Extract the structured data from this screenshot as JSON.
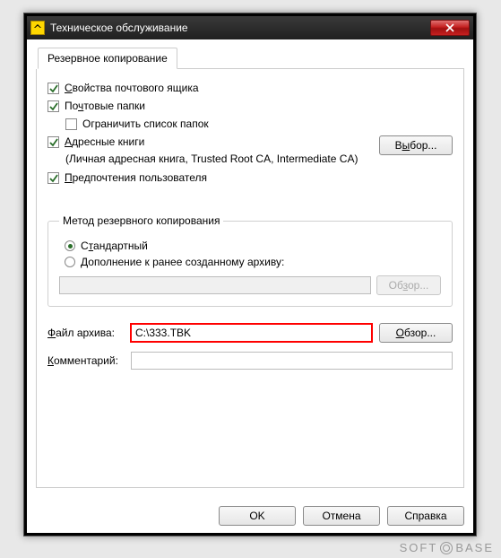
{
  "window": {
    "title": "Техническое обслуживание"
  },
  "tab": {
    "label": "Резервное копирование"
  },
  "checkboxes": {
    "mailbox_props": {
      "label_pre": "",
      "label_u": "С",
      "label_post": "войства почтового ящика",
      "checked": true
    },
    "mail_folders": {
      "label_pre": "По",
      "label_u": "ч",
      "label_post": "товые папки",
      "checked": true
    },
    "limit_folders": {
      "label": "Ограничить список папок",
      "checked": false
    },
    "address_books": {
      "label_pre": "",
      "label_u": "А",
      "label_post": "дресные книги",
      "checked": true
    },
    "address_desc": "(Личная адресная книга, Trusted Root CA, Intermediate CA)",
    "user_prefs": {
      "label_pre": "",
      "label_u": "П",
      "label_post": "редпочтения пользователя",
      "checked": true
    }
  },
  "select_btn": {
    "label_pre": "В",
    "label_u": "ы",
    "label_post": "бор..."
  },
  "fieldset": {
    "legend": "Метод резервного копирования",
    "radio_standard": {
      "label_pre": "С",
      "label_u": "т",
      "label_post": "андартный",
      "checked": true
    },
    "radio_append": {
      "label_pre": "",
      "label_u": "Д",
      "label_post": "ополнение к ранее созданному архиву:",
      "checked": false
    },
    "browse_disabled": {
      "label_pre": "Об",
      "label_u": "з",
      "label_post": "ор..."
    }
  },
  "file": {
    "label_pre": "",
    "label_u": "Ф",
    "label_post": "айл архива:",
    "value": "C:\\333.TBK",
    "browse": {
      "label_pre": "",
      "label_u": "О",
      "label_post": "бзор..."
    }
  },
  "comment": {
    "label_pre": "",
    "label_u": "К",
    "label_post": "омментарий:",
    "value": ""
  },
  "buttons": {
    "ok": "OK",
    "cancel": "Отмена",
    "help": "Справка"
  },
  "watermark": {
    "left": "SOFT",
    "right": "BASE"
  }
}
